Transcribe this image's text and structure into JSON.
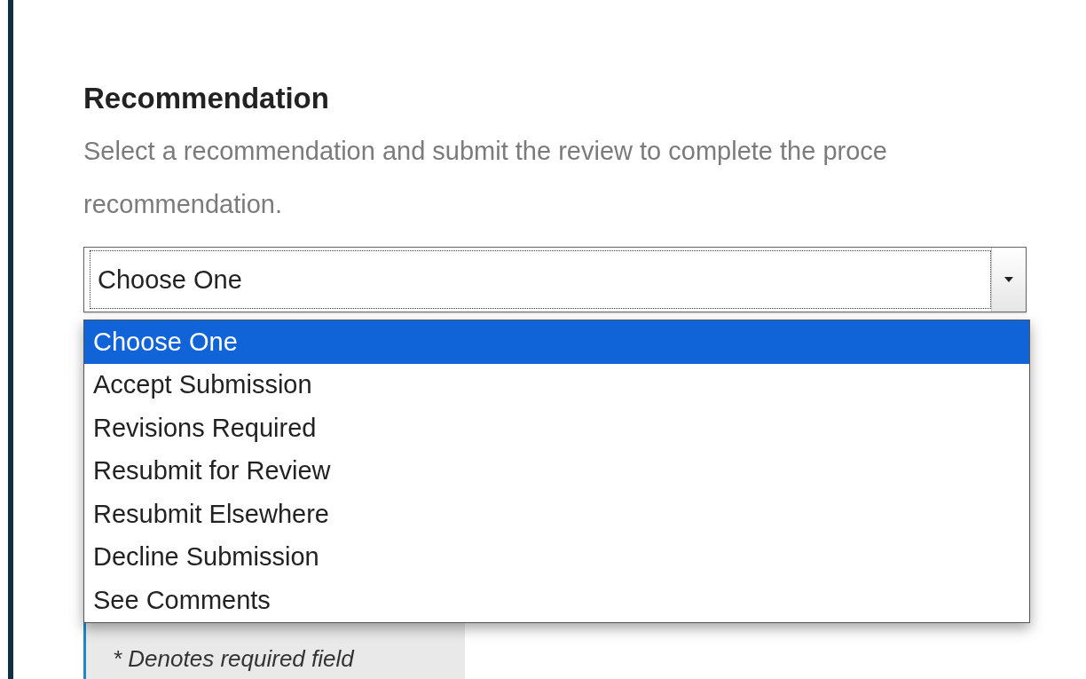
{
  "section": {
    "title": "Recommendation",
    "description_lines": [
      "Select a recommendation and submit the review to complete the proce",
      "recommendation."
    ]
  },
  "select": {
    "value": "Choose One",
    "expanded": true,
    "options": [
      {
        "label": "Choose One",
        "selected": true
      },
      {
        "label": "Accept Submission",
        "selected": false
      },
      {
        "label": "Revisions Required",
        "selected": false
      },
      {
        "label": "Resubmit for Review",
        "selected": false
      },
      {
        "label": "Resubmit Elsewhere",
        "selected": false
      },
      {
        "label": "Decline Submission",
        "selected": false
      },
      {
        "label": "See Comments",
        "selected": false
      }
    ]
  },
  "note": "* Denotes required field"
}
